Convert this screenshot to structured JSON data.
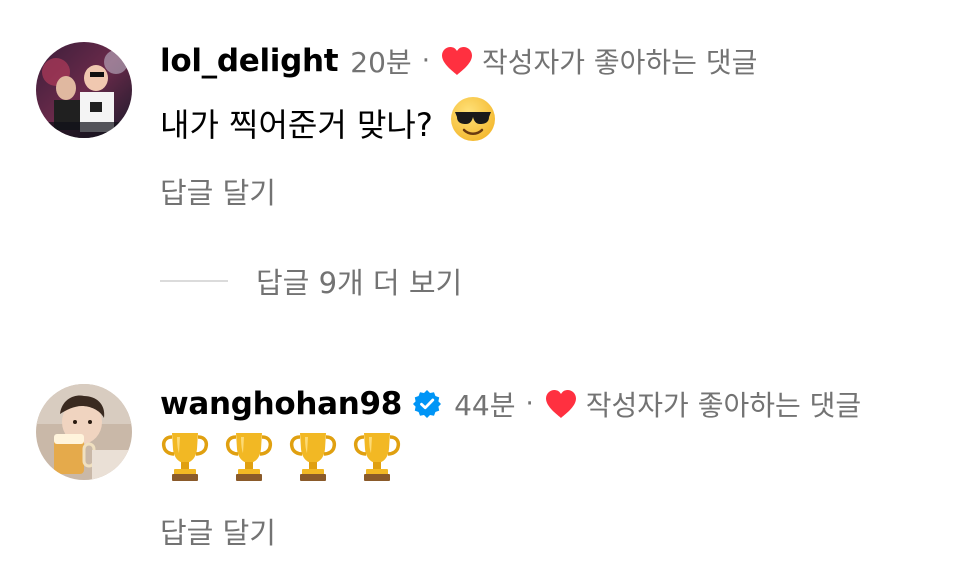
{
  "comments": [
    {
      "username": "lol_delight",
      "verified": false,
      "time": "20분",
      "separator": "·",
      "liked_by_author": "작성자가 좋아하는 댓글",
      "text": "내가 찍어준거 맞나?",
      "emoji_icon": "smiling-face-with-sunglasses-icon",
      "reply_label": "답글 달기"
    },
    {
      "username": "wanghohan98",
      "verified": true,
      "time": "44분",
      "separator": "·",
      "liked_by_author": "작성자가 좋아하는 댓글",
      "emoji_icon": "trophy-icon",
      "emoji_count": 4,
      "reply_label": "답글 달기"
    }
  ],
  "view_more_replies": "답글 9개 더 보기",
  "colors": {
    "text": "#000000",
    "secondary": "#737373",
    "heart": "#ff3040",
    "verified": "#0095f6",
    "divider": "#dbdbdb"
  }
}
